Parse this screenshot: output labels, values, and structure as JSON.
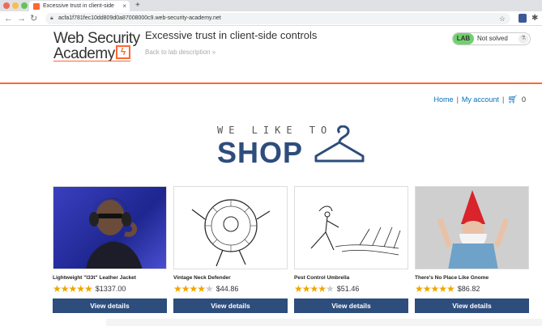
{
  "browser": {
    "tab_title": "Excessive trust in client-side",
    "url": "acfa1f781fec10dd809d0a87008000c9.web-security-academy.net",
    "icons": [
      "back-icon",
      "forward-icon",
      "reload-icon",
      "lock-icon",
      "star-icon",
      "extension-icon",
      "puzzle-icon"
    ]
  },
  "header": {
    "logo_line1": "Web Security",
    "logo_line2": "Academy",
    "lab_title": "Excessive trust in client-side controls",
    "back_link": "Back to lab description »",
    "lab_badge": "LAB",
    "lab_status": "Not solved"
  },
  "nav": {
    "home": "Home",
    "separator": "|",
    "my_account": "My account",
    "cart_count": "0"
  },
  "banner": {
    "line1": "WE LIKE TO",
    "line2": "SHOP"
  },
  "products": [
    {
      "name": "Lightweight \"l33t\" Leather Jacket",
      "stars": 5,
      "price": "$1337.00",
      "button": "View details"
    },
    {
      "name": "Vintage Neck Defender",
      "stars": 4,
      "price": "$44.86",
      "button": "View details"
    },
    {
      "name": "Pest Control Umbrella",
      "stars": 4,
      "price": "$51.46",
      "button": "View details"
    },
    {
      "name": "There's No Place Like Gnome",
      "stars": 5,
      "price": "$86.82",
      "button": "View details"
    }
  ],
  "colors": {
    "accent": "#ff6633",
    "primary": "#2d4d7c",
    "link": "#0071bc",
    "lab_green": "#70d16d"
  }
}
